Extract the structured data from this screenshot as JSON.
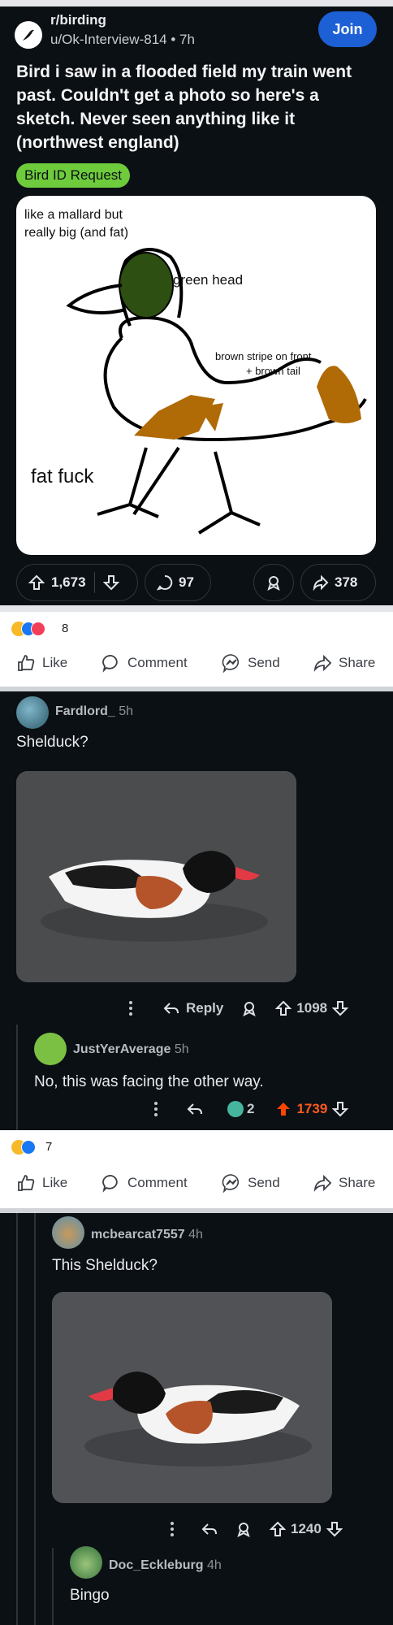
{
  "post": {
    "subreddit": "r/birding",
    "author": "u/Ok-Interview-814",
    "age": "7h",
    "join_label": "Join",
    "title": "Bird i saw in a flooded field my train went past. Couldn't get a photo so here's a sketch. Never seen anything like it (northwest england)",
    "flair": "Bird ID Request",
    "sketch": {
      "note_top": "like a mallard but really big (and fat)",
      "note_head": "green head",
      "note_stripe_1": "brown stripe on front",
      "note_stripe_2": "+ brown tail",
      "note_bottom": "fat fuck"
    },
    "upvotes": "1,673",
    "comments": "97",
    "shares": "378",
    "colors": {
      "join": "#1d5fd4",
      "flair": "#6ecb3c",
      "upvote_active": "#ff4500"
    }
  },
  "fb_bar_1": {
    "reaction_count": "8",
    "like": "Like",
    "comment": "Comment",
    "send": "Send",
    "share": "Share"
  },
  "comment_1": {
    "author": "Fardlord_",
    "age": "5h",
    "text": "Shelduck?",
    "reply_label": "Reply",
    "score": "1098"
  },
  "comment_2": {
    "author": "JustYerAverage",
    "age": "5h",
    "text": "No, this was facing the other way.",
    "award_count": "2",
    "score": "1739"
  },
  "fb_bar_2": {
    "reaction_count": "7",
    "like": "Like",
    "comment": "Comment",
    "send": "Send",
    "share": "Share"
  },
  "comment_3": {
    "author": "mcbearcat7557",
    "age": "4h",
    "text": "This Shelduck?",
    "score": "1240"
  },
  "comment_4": {
    "author": "Doc_Eckleburg",
    "age": "4h",
    "text": "Bingo"
  }
}
